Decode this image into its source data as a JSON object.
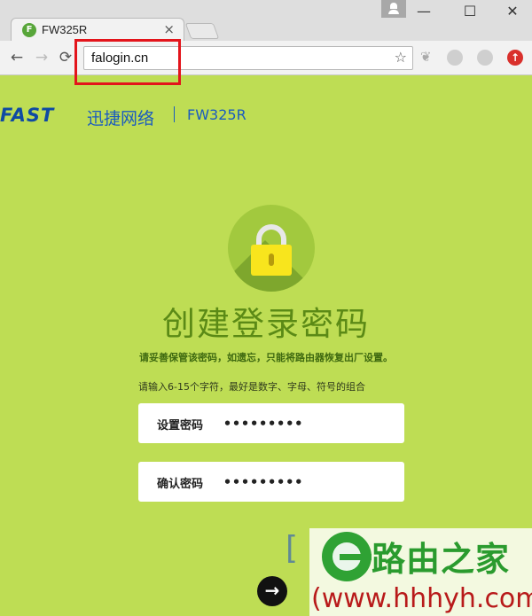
{
  "browser": {
    "tab_favicon": "F",
    "tab_title": "FW325R",
    "tab_close": "×",
    "address": "falogin.cn",
    "nav": {
      "back": "←",
      "forward": "→",
      "reload": "⟳"
    },
    "star": "☆",
    "window": {
      "minimize": "—",
      "maximize": "☐",
      "close": "✕"
    }
  },
  "brand": {
    "logo": "FAST",
    "name_cn": "迅捷网络",
    "model": "FW325R"
  },
  "page": {
    "title": "创建登录密码",
    "warning": "请妥善保管该密码，如遗忘，只能将路由器恢复出厂设置。",
    "hint": "请输入6-15个字符，最好是数字、字母、符号的组合",
    "password_label": "设置密码",
    "password_value": "•••••••••",
    "confirm_label": "确认密码",
    "confirm_value": "•••••••••",
    "next": "→"
  },
  "watermark": {
    "bracket": "[",
    "title": "路由之家",
    "url": "(www.hhhyh.com)"
  },
  "colors": {
    "background": "#bedd54",
    "brand_blue": "#1a5bbf",
    "title_green": "#5b8a16",
    "highlight_red": "#e3141b"
  }
}
